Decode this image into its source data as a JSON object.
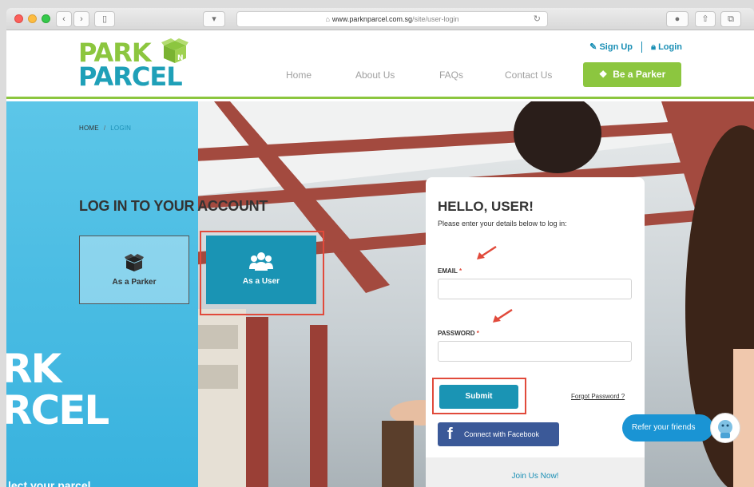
{
  "browser": {
    "url_host": "www.parknparcel.com.sg",
    "url_path": "/site/user-login"
  },
  "header": {
    "logo_line1": "PARK",
    "logo_line2": "PARCEL",
    "signup_label": "Sign Up",
    "login_label": "Login",
    "nav": [
      "Home",
      "About Us",
      "FAQs",
      "Contact Us"
    ],
    "cta_label": "Be a Parker"
  },
  "breadcrumb": {
    "home": "HOME",
    "current": "LOGIN"
  },
  "login": {
    "title": "LOG IN TO YOUR ACCOUNT",
    "parker_label": "As a Parker",
    "user_label": "As a User"
  },
  "form": {
    "heading": "HELLO, USER!",
    "instructions": "Please enter your details below to log in:",
    "email_label": "EMAIL",
    "password_label": "PASSWORD",
    "required_mark": "*",
    "submit_label": "Submit",
    "forgot_label": "Forgot Password ?",
    "facebook_label": "Connect with Facebook",
    "join_label": "Join Us Now!"
  },
  "banner": {
    "line1": "RK",
    "line2": "RCEL",
    "line3": "lect your parcel"
  },
  "refer": {
    "label": "Refer your friends"
  },
  "colors": {
    "brand_green": "#8cc63f",
    "brand_blue": "#1a94b4",
    "facebook": "#3b5998",
    "highlight": "#e14a3b"
  }
}
